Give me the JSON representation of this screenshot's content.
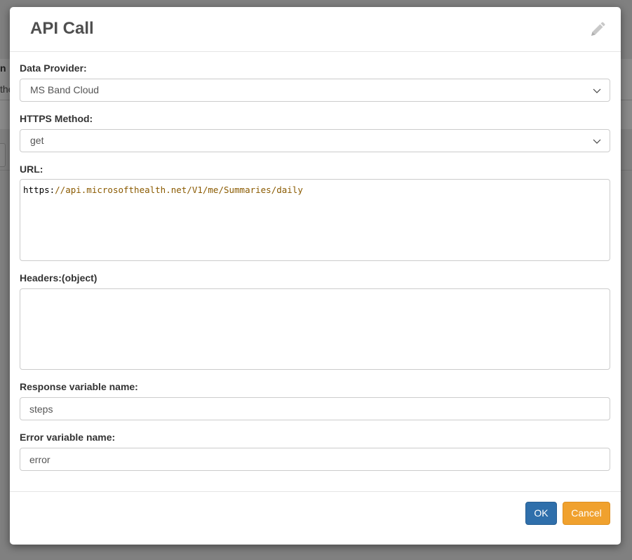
{
  "background": {
    "fragment_column_header": "n",
    "fragment_cell": "the"
  },
  "dialog": {
    "title": "API Call",
    "edit_icon": "pencil-icon"
  },
  "form": {
    "data_provider": {
      "label": "Data Provider:",
      "value": "MS Band Cloud"
    },
    "https_method": {
      "label": "HTTPS Method:",
      "value": "get"
    },
    "url": {
      "label": "URL:",
      "scheme": "https:",
      "rest": "//api.microsofthealth.net/V1/me/Summaries/daily"
    },
    "headers": {
      "label": "Headers:(object)",
      "value": ""
    },
    "response_variable": {
      "label": "Response variable name:",
      "value": "steps"
    },
    "error_variable": {
      "label": "Error variable name:",
      "value": "error"
    }
  },
  "footer": {
    "ok_label": "OK",
    "cancel_label": "Cancel"
  },
  "colors": {
    "ok_button": "#2f6fab",
    "cancel_button": "#f0a12e",
    "url_string": "#8a5a00"
  }
}
